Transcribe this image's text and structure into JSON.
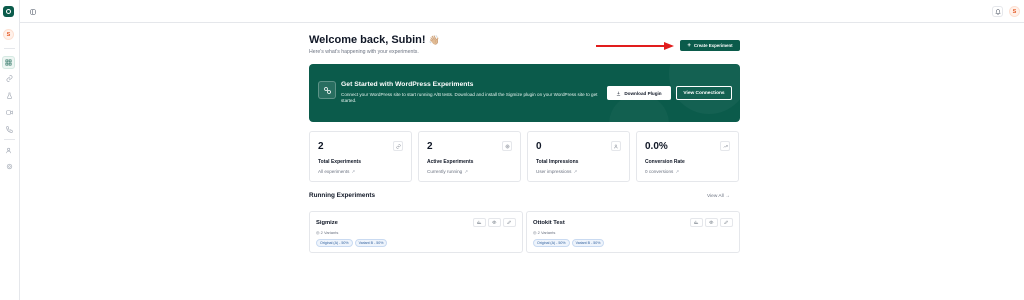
{
  "sidebar": {
    "logo_icon": "logo-icon",
    "avatar_initial": "S",
    "items": [
      {
        "name": "dashboard",
        "icon": "grid-icon",
        "active": true
      },
      {
        "name": "links",
        "icon": "link-icon",
        "active": false
      },
      {
        "name": "tests",
        "icon": "flask-icon",
        "active": false
      },
      {
        "name": "video",
        "icon": "video-icon",
        "active": false
      },
      {
        "name": "calls",
        "icon": "phone-icon",
        "active": false
      },
      {
        "name": "users",
        "icon": "users-icon",
        "active": false
      },
      {
        "name": "settings",
        "icon": "gear-icon",
        "active": false
      }
    ]
  },
  "topbar": {
    "menu_icon": "sidebar-toggle-icon",
    "bell_icon": "bell-icon",
    "avatar_initial": "S"
  },
  "header": {
    "title": "Welcome back, Subin!",
    "emoji": "👋🏼",
    "subtitle": "Here's what's happening with your experiments.",
    "create_button": "Create Experiment"
  },
  "banner": {
    "title": "Get Started with WordPress Experiments",
    "description": "Connect your WordPress site to start running A/B tests. Download and install the Sigmize plugin on your WordPress site to get started.",
    "download_button": "Download Plugin",
    "connect_button": "View Connections"
  },
  "stats": [
    {
      "value": "2",
      "label": "Total Experiments",
      "link": "All experiments",
      "icon": "link-icon"
    },
    {
      "value": "2",
      "label": "Active Experiments",
      "link": "Currently running",
      "icon": "target-icon"
    },
    {
      "value": "0",
      "label": "Total Impressions",
      "link": "User impressions",
      "icon": "users-icon"
    },
    {
      "value": "0.0%",
      "label": "Conversion Rate",
      "link": "0 conversions",
      "icon": "trend-up-icon"
    }
  ],
  "running": {
    "title": "Running Experiments",
    "view_all": "View All",
    "experiments": [
      {
        "name": "Sigmize",
        "variants": "2 Variants",
        "tags": [
          "Original (A) - 50%",
          "Variant B - 50%"
        ]
      },
      {
        "name": "Ottokit Test",
        "variants": "2 Variants",
        "tags": [
          "Original (A) - 50%",
          "Variant B - 50%"
        ]
      }
    ]
  },
  "colors": {
    "brand": "#0b5b4b",
    "accent_orange": "#e45a25",
    "annotation_arrow": "#e11d1d"
  }
}
